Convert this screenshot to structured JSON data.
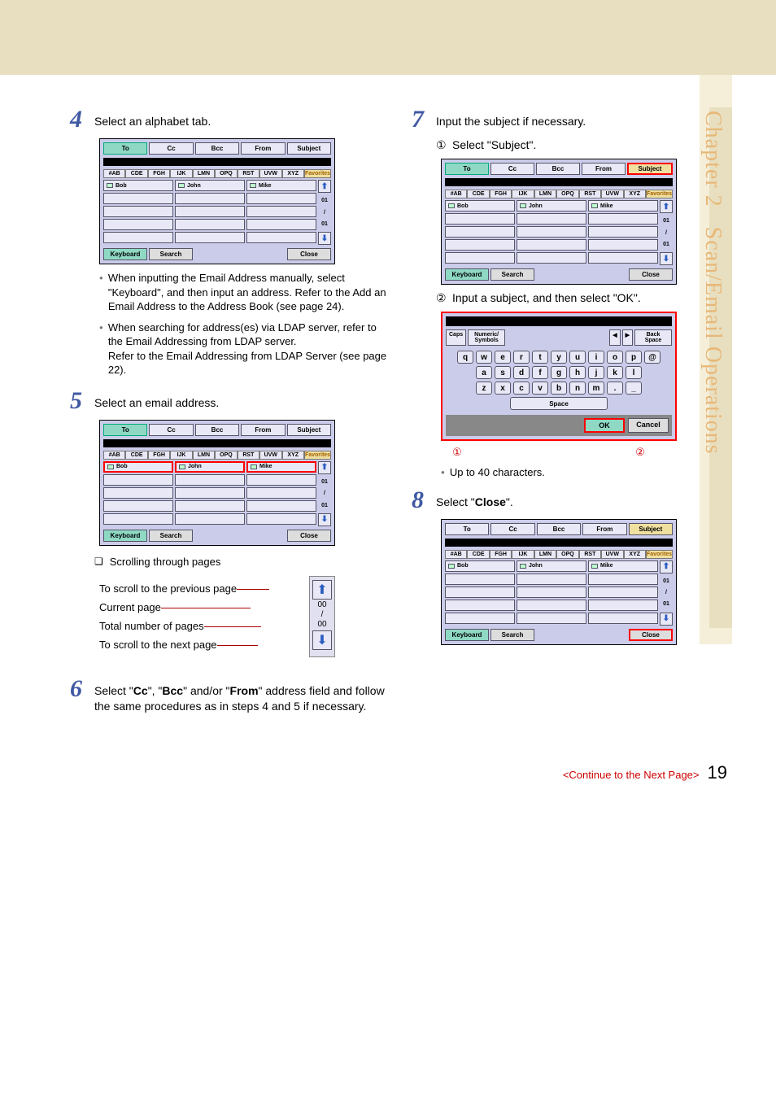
{
  "sidebar": {
    "chapter": "Chapter 2",
    "title": "Scan/Email Operations"
  },
  "steps": {
    "s4": {
      "num": "4",
      "text": "Select an alphabet tab."
    },
    "s5": {
      "num": "5",
      "text": "Select an email address."
    },
    "s6": {
      "num": "6",
      "text_pre": "Select \"",
      "b1": "Cc",
      "m1": "\", \"",
      "b2": "Bcc",
      "m2": "\" and/or \"",
      "b3": "From",
      "text_post": "\" address field and follow the same procedures as in steps 4 and 5 if necessary."
    },
    "s7": {
      "num": "7",
      "text": "Input the subject if necessary."
    },
    "s8": {
      "num": "8",
      "text_pre": "Select \"",
      "b1": "Close",
      "text_post": "\"."
    }
  },
  "bullets": {
    "b4a_pre": "When inputting the Email Address manually, select \"",
    "b4a_bold1": "Keyboard",
    "b4a_mid": "\", and then input an address. Refer to the ",
    "b4a_bold2": "Add an Email Address to the Address Book",
    "b4a_post": " (see page 24).",
    "b4b_pre": "When searching for address(es) via LDAP server, refer to the Email Addressing from LDAP server.",
    "b4b_mid": "Refer to the ",
    "b4b_bold": "Email Addressing from LDAP Server",
    "b4b_post": " (see page 22).",
    "scroll_title": "Scrolling through pages",
    "up40": "Up to 40 characters."
  },
  "substeps": {
    "s7_1_num": "①",
    "s7_1_pre": "Select \"",
    "s7_1_b": "Subject",
    "s7_1_post": "\".",
    "s7_2_num": "②",
    "s7_2_pre": "Input a subject, and then select \"",
    "s7_2_b": "OK",
    "s7_2_post": "\"."
  },
  "panel": {
    "tabs": [
      "To",
      "Cc",
      "Bcc",
      "From",
      "Subject"
    ],
    "alpha": [
      "#AB",
      "CDE",
      "FGH",
      "IJK",
      "LMN",
      "OPQ",
      "RST",
      "UVW",
      "XYZ"
    ],
    "fav": "Favorites",
    "names": [
      "Bob",
      "John",
      "Mike"
    ],
    "keyboard": "Keyboard",
    "search": "Search",
    "close": "Close",
    "page_cur": "01",
    "page_tot": "01"
  },
  "scrollbox": {
    "prev": "To scroll to the previous page",
    "cur": "Current page",
    "tot": "Total number of pages",
    "next": "To scroll to the next page",
    "n1": "00",
    "n2": "00"
  },
  "keyboard": {
    "caps": "Caps",
    "numsym": "Numeric/\nSymbols",
    "backspace": "Back Space",
    "row1": [
      "q",
      "w",
      "e",
      "r",
      "t",
      "y",
      "u",
      "i",
      "o",
      "p",
      "@"
    ],
    "row2": [
      "a",
      "s",
      "d",
      "f",
      "g",
      "h",
      "j",
      "k",
      "l"
    ],
    "row3": [
      "z",
      "x",
      "c",
      "v",
      "b",
      "n",
      "m",
      ".",
      "_"
    ],
    "space": "Space",
    "ok": "OK",
    "cancel": "Cancel",
    "callout1": "①",
    "callout2": "②"
  },
  "footer": {
    "cont": "<Continue to the Next Page>",
    "page": "19"
  }
}
